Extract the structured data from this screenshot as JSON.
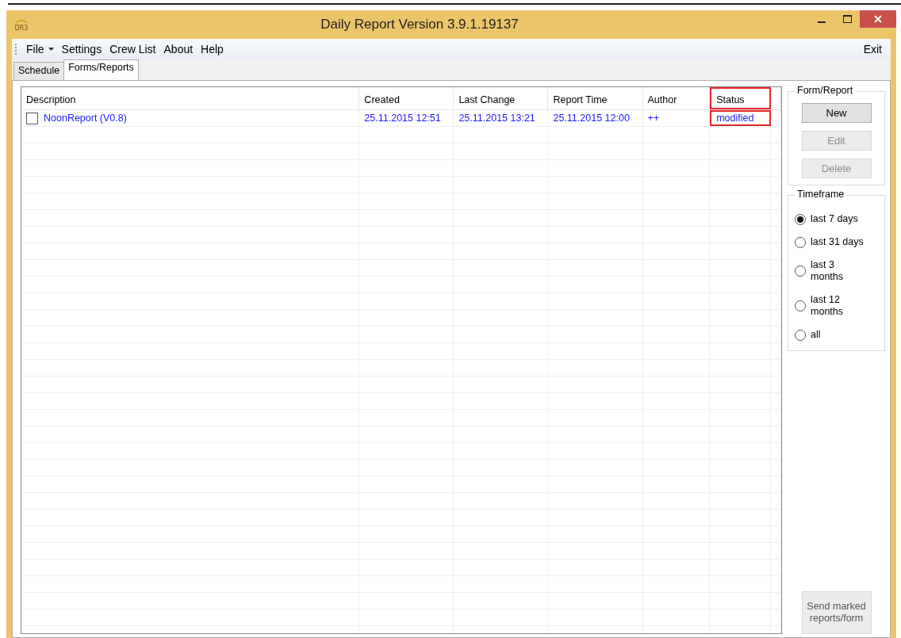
{
  "window": {
    "title": "Daily Report Version 3.9.1.19137",
    "app_icon_text": "DR3"
  },
  "menu": [
    {
      "label": "File",
      "dropdown": true
    },
    {
      "label": "Settings",
      "dropdown": false
    },
    {
      "label": "Crew List",
      "dropdown": false
    },
    {
      "label": "About",
      "dropdown": false
    },
    {
      "label": "Help",
      "dropdown": false
    }
  ],
  "menu_right": "Exit",
  "tabs": [
    {
      "label": "Schedule",
      "selected": false
    },
    {
      "label": "Forms/Reports",
      "selected": true
    }
  ],
  "table": {
    "columns": [
      {
        "label": "Description",
        "highlighted": false
      },
      {
        "label": "Created",
        "highlighted": false
      },
      {
        "label": "Last Change",
        "highlighted": false
      },
      {
        "label": "Report Time",
        "highlighted": false
      },
      {
        "label": "Author",
        "highlighted": false
      },
      {
        "label": "Status",
        "highlighted": true
      }
    ],
    "rows": [
      {
        "checked": false,
        "cells": [
          "NoonReport (V0.8)",
          "25.11.2015 12:51",
          "25.11.2015 13:21",
          "25.11.2015 12:00",
          "++",
          "modified"
        ]
      }
    ]
  },
  "form_report": {
    "title": "Form/Report",
    "buttons": [
      {
        "label": "New",
        "disabled": false
      },
      {
        "label": "Edit",
        "disabled": true
      },
      {
        "label": "Delete",
        "disabled": true
      }
    ]
  },
  "timeframe": {
    "title": "Timeframe",
    "options": [
      {
        "label": "last 7 days",
        "selected": true
      },
      {
        "label": "last 31 days",
        "selected": false
      },
      {
        "label": "last 3 months",
        "selected": false
      },
      {
        "label": "last 12 months",
        "selected": false
      },
      {
        "label": "all",
        "selected": false
      }
    ]
  },
  "send_button": {
    "label": "Send marked reports/form",
    "disabled": true
  }
}
